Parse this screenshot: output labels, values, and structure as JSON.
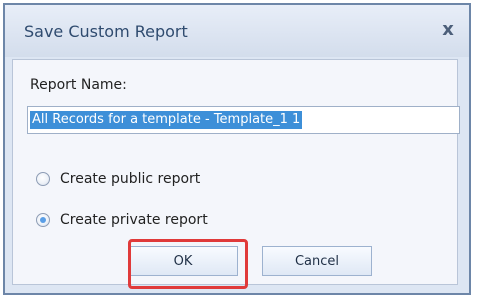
{
  "dialog": {
    "title": "Save Custom Report",
    "close_glyph": "x"
  },
  "form": {
    "report_name_label": "Report Name:",
    "report_name_value": "All Records for a template - Template_1 1"
  },
  "options": [
    {
      "label": "Create public report",
      "selected": false
    },
    {
      "label": "Create private report",
      "selected": true
    }
  ],
  "buttons": {
    "ok": "OK",
    "cancel": "Cancel"
  },
  "colors": {
    "highlight": "#e03a3a",
    "selection": "#3d8fd8"
  },
  "icons": {
    "close": "close-icon"
  }
}
